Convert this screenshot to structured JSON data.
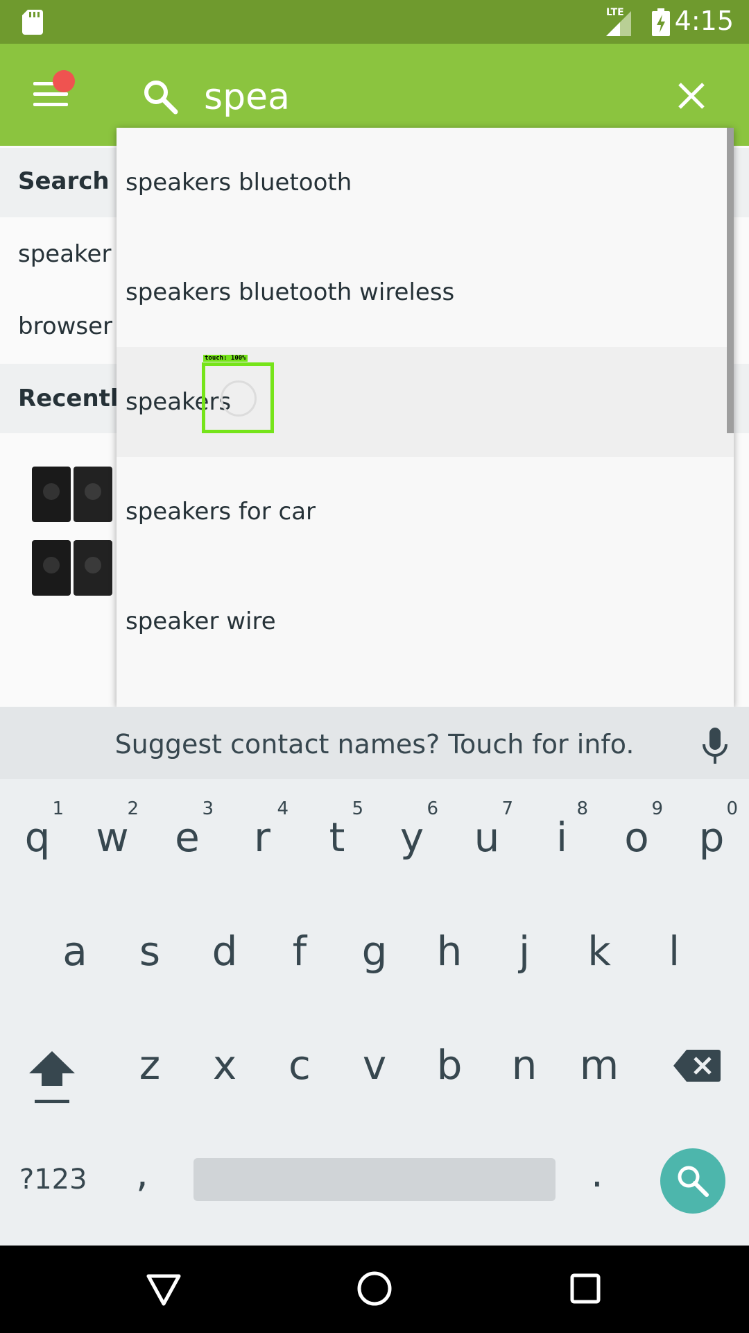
{
  "status_bar": {
    "time": "4:15",
    "network": "LTE",
    "icons": [
      "sd-card-icon",
      "lte-signal-icon",
      "battery-charging-icon"
    ]
  },
  "toolbar": {
    "search_value": "spea",
    "colors": {
      "toolbar": "#8bc43f",
      "status_bar": "#6f9a2e",
      "notification_dot": "#ef5350"
    }
  },
  "background": {
    "search_history_title": "Search H",
    "history_items": [
      "speaker",
      "browser"
    ],
    "recently_title": "Recently"
  },
  "suggestions": [
    "speakers bluetooth",
    "speakers bluetooth wireless",
    "speakers",
    "speakers for car",
    "speaker wire"
  ],
  "touch_marker": {
    "label": "touch: 100%"
  },
  "keyboard": {
    "suggest_text": "Suggest contact names? Touch for info.",
    "row1": [
      {
        "letter": "q",
        "hint": "1"
      },
      {
        "letter": "w",
        "hint": "2"
      },
      {
        "letter": "e",
        "hint": "3"
      },
      {
        "letter": "r",
        "hint": "4"
      },
      {
        "letter": "t",
        "hint": "5"
      },
      {
        "letter": "y",
        "hint": "6"
      },
      {
        "letter": "u",
        "hint": "7"
      },
      {
        "letter": "i",
        "hint": "8"
      },
      {
        "letter": "o",
        "hint": "9"
      },
      {
        "letter": "p",
        "hint": "0"
      }
    ],
    "row2": [
      "a",
      "s",
      "d",
      "f",
      "g",
      "h",
      "j",
      "k",
      "l"
    ],
    "row3": [
      "z",
      "x",
      "c",
      "v",
      "b",
      "n",
      "m"
    ],
    "symbols_label": "?123",
    "comma": ",",
    "period": ".",
    "accent_color": "#4db6ac"
  }
}
